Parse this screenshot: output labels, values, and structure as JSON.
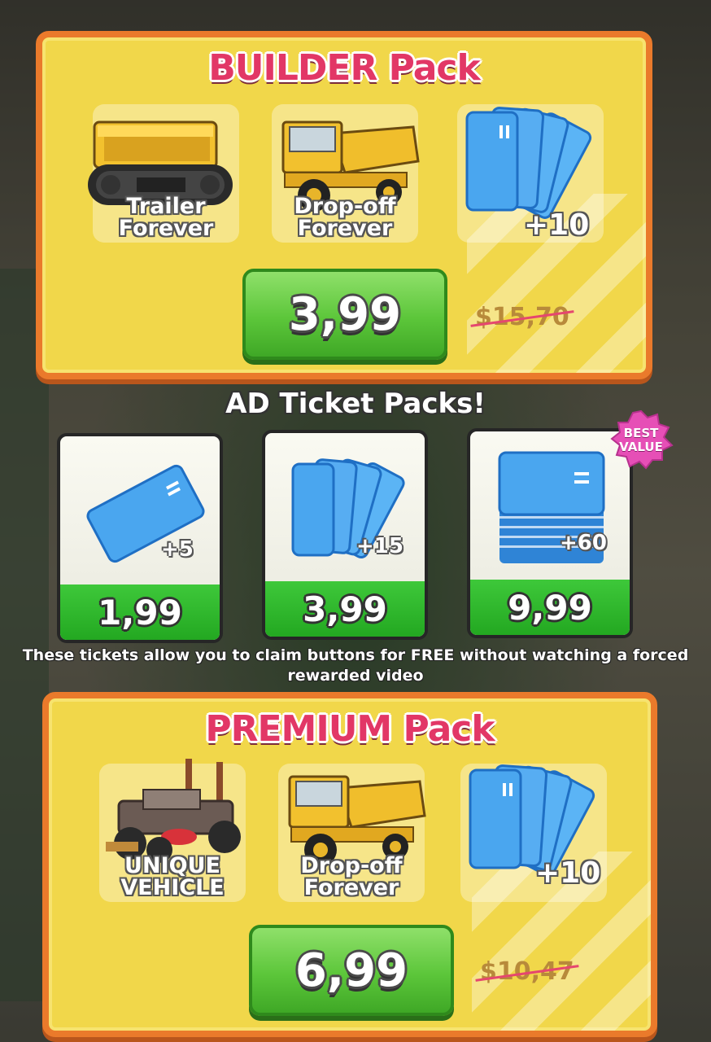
{
  "builder_pack": {
    "title": "BUILDER Pack",
    "items": [
      {
        "label": "Trailer\nForever",
        "icon": "tracked-trailer-icon"
      },
      {
        "label": "Drop-off\nForever",
        "icon": "dump-truck-icon"
      },
      {
        "label": "+10",
        "icon": "ad-tickets-icon"
      }
    ],
    "price": "3,99",
    "old_price": "$15,70"
  },
  "ad_section": {
    "title": "AD Ticket Packs!",
    "best_badge": "BEST\nVALUE",
    "cards": [
      {
        "qty": "+5",
        "price": "1,99",
        "icon": "single-ticket-icon"
      },
      {
        "qty": "+15",
        "price": "3,99",
        "icon": "ticket-fan-icon"
      },
      {
        "qty": "+60",
        "price": "9,99",
        "icon": "ticket-stack-icon"
      }
    ],
    "info": "These tickets allow you to claim buttons for FREE without watching a forced rewarded video"
  },
  "premium_pack": {
    "title": "PREMIUM Pack",
    "items": [
      {
        "label": "UNIQUE\nVEHICLE",
        "icon": "armored-buggy-icon"
      },
      {
        "label": "Drop-off\nForever",
        "icon": "dump-truck-icon"
      },
      {
        "label": "+10",
        "icon": "ad-tickets-icon"
      }
    ],
    "price": "6,99",
    "old_price": "$10,47"
  },
  "colors": {
    "panel_bg": "#f1d74a",
    "panel_border": "#ea7a2b",
    "title_pink": "#e23766",
    "button_green": "#5cc63a",
    "ticket_blue": "#4aa6ef",
    "badge_pink": "#e64fb6"
  }
}
